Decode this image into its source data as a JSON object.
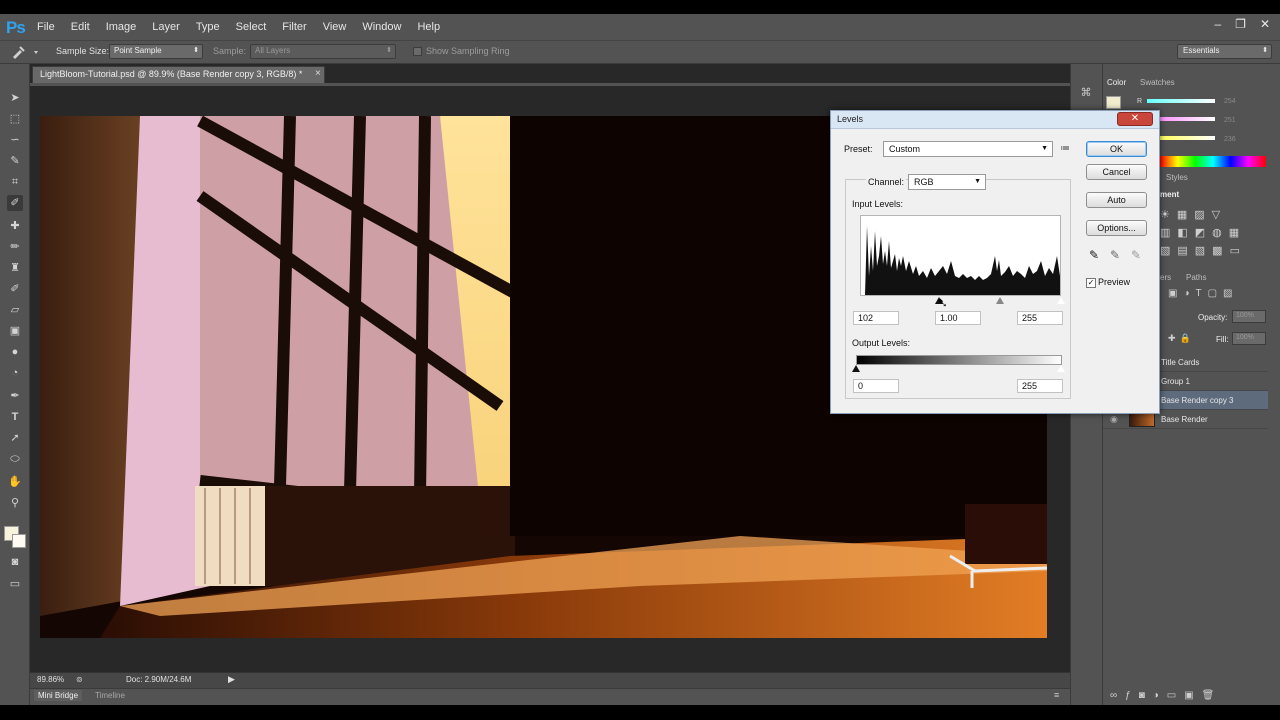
{
  "app": {
    "logo": "Ps"
  },
  "menu": [
    "File",
    "Edit",
    "Image",
    "Layer",
    "Type",
    "Select",
    "Filter",
    "View",
    "Window",
    "Help"
  ],
  "window_controls": {
    "minimize": "–",
    "restore": "❐",
    "close": "✕"
  },
  "options_bar": {
    "sample_size_label": "Sample Size:",
    "sample_size_value": "Point Sample",
    "sample_label": "Sample:",
    "sample_value": "All Layers",
    "show_sampling_ring": "Show Sampling Ring"
  },
  "workspace": "Essentials",
  "document": {
    "tab_title": "LightBloom-Tutorial.psd @ 89.9% (Base Render copy 3, RGB/8) *",
    "tab_close": "×",
    "zoom": "89.86%",
    "doc_size": "Doc: 2.90M/24.6M"
  },
  "bottom_tabs": {
    "mini_bridge": "Mini Bridge",
    "timeline": "Timeline"
  },
  "panels": {
    "color_tab": "Color",
    "swatches_tab": "Swatches",
    "color_channel": "R",
    "color_values": [
      "254",
      "251",
      "236"
    ],
    "adjustments_partial": "ment",
    "styles_tab": "Styles",
    "layers_tab_partial": "ers",
    "paths_tab": "Paths",
    "opacity_label": "Opacity:",
    "opacity_value": "100%",
    "fill_label": "Fill:",
    "fill_value": "100%"
  },
  "layers": [
    {
      "name": "Title Cards",
      "selected": false
    },
    {
      "name": "Group 1",
      "selected": false
    },
    {
      "name": "Base Render copy 3",
      "selected": true
    },
    {
      "name": "Base Render",
      "selected": false
    }
  ],
  "levels_dialog": {
    "title": "Levels",
    "close": "✕",
    "preset_label": "Preset:",
    "preset_value": "Custom",
    "channel_label": "Channel:",
    "channel_value": "RGB",
    "input_levels_label": "Input Levels:",
    "input_black": "102",
    "input_gamma": "1.00",
    "input_white": "255",
    "output_levels_label": "Output Levels:",
    "output_black": "0",
    "output_white": "255",
    "ok": "OK",
    "cancel": "Cancel",
    "auto": "Auto",
    "options": "Options...",
    "preview_label": "Preview",
    "preview_checked": true
  },
  "icons": [
    "eyedropper-icon",
    "move-icon",
    "marquee-icon",
    "lasso-icon",
    "crop-icon",
    "brush-icon",
    "stamp-icon",
    "eraser-icon",
    "gradient-icon",
    "dodge-icon",
    "pen-icon",
    "type-icon",
    "path-select-icon",
    "shape-icon",
    "hand-icon",
    "zoom-icon"
  ]
}
